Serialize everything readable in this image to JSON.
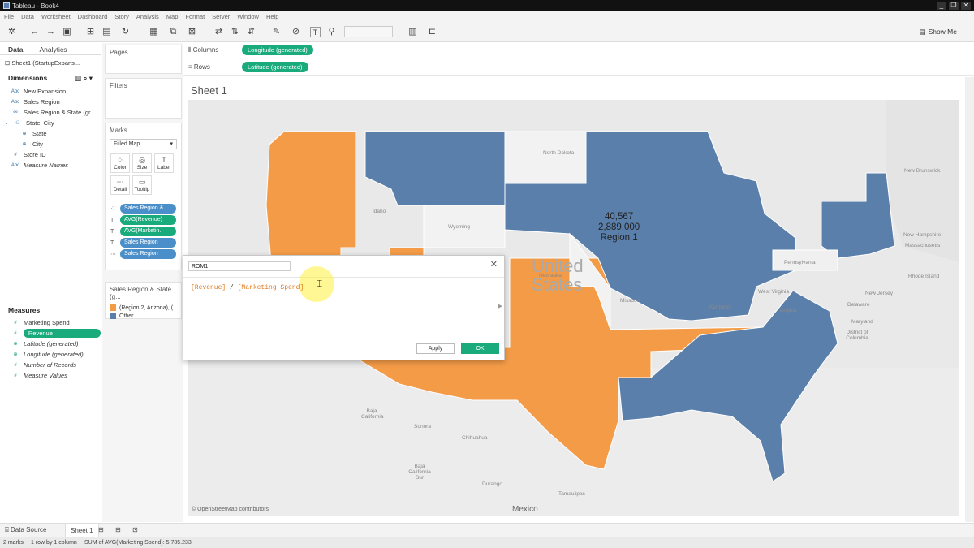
{
  "window": {
    "title": "Tableau - Book4",
    "controls": [
      "_",
      "❐",
      "✕"
    ]
  },
  "menu": [
    "File",
    "Data",
    "Worksheet",
    "Dashboard",
    "Story",
    "Analysis",
    "Map",
    "Format",
    "Server",
    "Window",
    "Help"
  ],
  "toolbar": {
    "show_me": "Show Me"
  },
  "data_pane": {
    "tabs": [
      "Data",
      "Analytics"
    ],
    "datasource": "Sheet1 (StartupExpans...",
    "dimensions_label": "Dimensions",
    "dimensions": [
      {
        "icon": "Abc",
        "label": "New Expansion"
      },
      {
        "icon": "Abc",
        "label": "Sales Region"
      },
      {
        "icon": "⚯",
        "label": "Sales Region & State (gr..."
      },
      {
        "icon": "⚇",
        "label": "State, City"
      },
      {
        "icon": "⊕",
        "label": "State"
      },
      {
        "icon": "⊕",
        "label": "City"
      },
      {
        "icon": "#",
        "label": "Store ID"
      },
      {
        "icon": "Abc",
        "label": "Measure Names"
      }
    ],
    "measures_label": "Measures",
    "measures": [
      {
        "icon": "#",
        "label": "Marketing Spend"
      },
      {
        "icon": "#",
        "label": "Revenue"
      },
      {
        "icon": "⊕",
        "label": "Latitude (generated)"
      },
      {
        "icon": "⊕",
        "label": "Longitude (generated)"
      },
      {
        "icon": "#",
        "label": "Number of Records"
      },
      {
        "icon": "#",
        "label": "Measure Values"
      }
    ]
  },
  "pages_label": "Pages",
  "filters_label": "Filters",
  "marks": {
    "label": "Marks",
    "type": "Filled Map",
    "buttons": [
      {
        "glyph": "⁘",
        "label": "Color"
      },
      {
        "glyph": "◎",
        "label": "Size"
      },
      {
        "glyph": "T",
        "label": "Label"
      },
      {
        "glyph": "⋯",
        "label": "Detail"
      },
      {
        "glyph": "▭",
        "label": "Tooltip"
      }
    ],
    "pills": [
      {
        "icon": "⁘",
        "label": "Sales Region &..",
        "color": "#4a8fc9"
      },
      {
        "icon": "T",
        "label": "AVG(Revenue)",
        "color": "#1aab7c"
      },
      {
        "icon": "T",
        "label": "AVG(Marketin..",
        "color": "#1aab7c"
      },
      {
        "icon": "T",
        "label": "Sales Region",
        "color": "#4a8fc9"
      },
      {
        "icon": "⋯",
        "label": "Sales Region",
        "color": "#4a8fc9"
      }
    ]
  },
  "legend": {
    "title": "Sales Region & State (g...",
    "items": [
      {
        "label": "(Region 2, Arizona), (...",
        "color": "#f39b47"
      },
      {
        "label": "Other",
        "color": "#5a7fab"
      }
    ]
  },
  "shelves": {
    "columns_label": "Columns",
    "columns_pill": "Longitude (generated)",
    "rows_label": "Rows",
    "rows_pill": "Latitude (generated)"
  },
  "sheet": {
    "title": "Sheet 1",
    "map_labels": [
      "North Dakota",
      "Idaho",
      "Wyoming",
      "Nebraska",
      "Missouri",
      "Kentucky",
      "Pennsylvania",
      "West Virginia",
      "Virginia",
      "New Brunswick",
      "New Hampshire",
      "Massachusetts",
      "Rhode Island",
      "New Jersey",
      "Delaware",
      "Maryland",
      "District of Columbia",
      "Baja California",
      "Sonora",
      "Chihuahua",
      "Baja California Sur",
      "Durango",
      "Tamaulipas",
      "Mexico"
    ],
    "watermark": [
      "United",
      "States"
    ],
    "region_label": {
      "value1": "40,567",
      "value2": "2,889.000",
      "name": "Region 1"
    },
    "attribution": "© OpenStreetMap contributors",
    "colors": {
      "orange": "#f39b47",
      "blue": "#5a7fab"
    }
  },
  "calc_dialog": {
    "name": "ROM1",
    "formula_field1": "[Revenue]",
    "formula_op": " / ",
    "formula_field2": "[Marketing Spend]",
    "apply": "Apply",
    "ok": "OK"
  },
  "sheet_tabs": {
    "data_source": "Data Source",
    "sheet1": "Sheet 1"
  },
  "status": {
    "marks": "2 marks",
    "dims": "1 row by 1 column",
    "sum": "SUM of AVG(Marketing Spend): 5,785.233"
  }
}
